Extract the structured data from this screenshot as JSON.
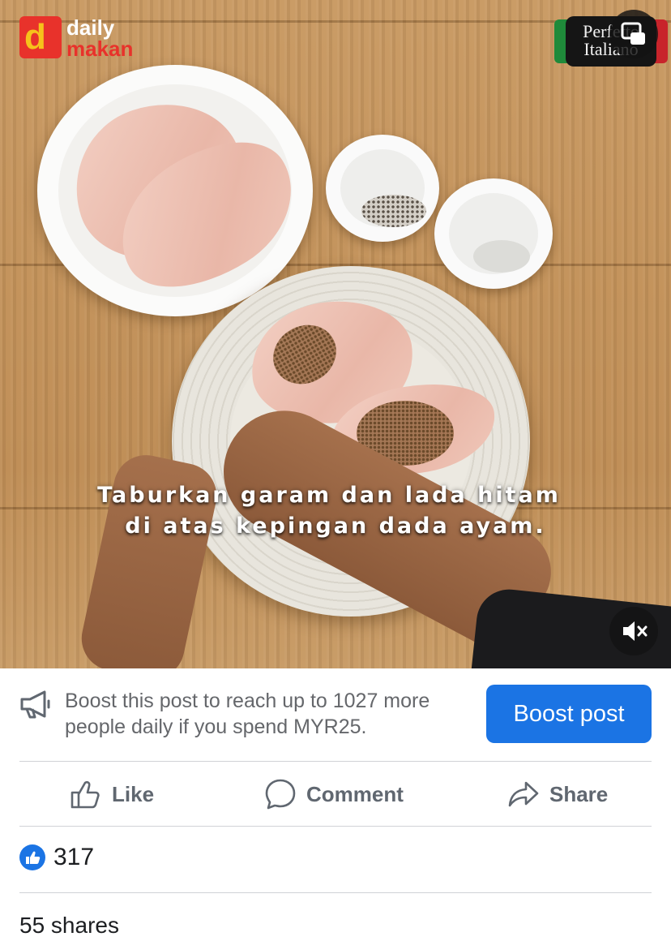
{
  "video": {
    "logo": {
      "letter": "d",
      "word1": "daily",
      "word2": "makan"
    },
    "badge_text": "Perfetto\nItaliano",
    "caption_lines": [
      "Taburkan garam dan lada hitam",
      "di atas kepingan dada ayam."
    ]
  },
  "boost": {
    "text": "Boost this post to reach up to 1027 more people daily if you spend MYR25.",
    "button_label": "Boost post"
  },
  "actions": {
    "like_label": "Like",
    "comment_label": "Comment",
    "share_label": "Share"
  },
  "stats": {
    "reaction_count": "317",
    "shares_text": "55 shares"
  },
  "colors": {
    "accent": "#1b74e4",
    "secondary_text": "#65676b",
    "action_text": "#606770",
    "logo_red": "#e8322b",
    "logo_yellow": "#f6c21b"
  }
}
